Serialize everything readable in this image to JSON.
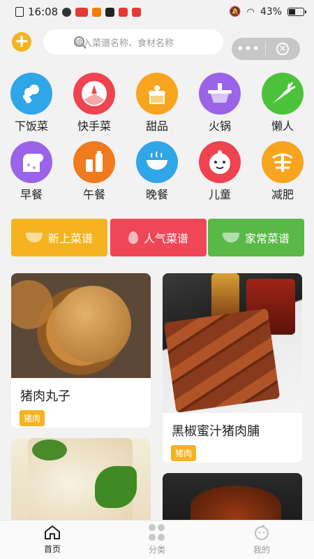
{
  "status_bar": {
    "time": "16:08",
    "battery": "43%"
  },
  "header": {
    "add_icon": "plus-icon",
    "search_placeholder": "输入菜谱名称、食材名称",
    "more_label": "•••",
    "close_label": "×"
  },
  "categories": [
    {
      "label": "下饭菜",
      "icon": "broccoli-icon",
      "color": "#2fa6e8"
    },
    {
      "label": "快手菜",
      "icon": "fan-icon",
      "color": "#ef4350"
    },
    {
      "label": "甜品",
      "icon": "cake-icon",
      "color": "#f7a51e"
    },
    {
      "label": "火锅",
      "icon": "hotpot-icon",
      "color": "#9a63e8"
    },
    {
      "label": "懒人",
      "icon": "carrot-icon",
      "color": "#4cc23b"
    },
    {
      "label": "早餐",
      "icon": "toast-icon",
      "color": "#9a63e8"
    },
    {
      "label": "午餐",
      "icon": "bottles-icon",
      "color": "#f07a1e"
    },
    {
      "label": "晚餐",
      "icon": "bowl-icon",
      "color": "#2fa6e8"
    },
    {
      "label": "儿童",
      "icon": "baby-icon",
      "color": "#ef4350"
    },
    {
      "label": "减肥",
      "icon": "scale-icon",
      "color": "#f7a51e"
    }
  ],
  "tabs": [
    {
      "label": "新上菜谱",
      "color": "#f6b321"
    },
    {
      "label": "人气菜谱",
      "color": "#ef4757"
    },
    {
      "label": "家常菜谱",
      "color": "#58b947"
    }
  ],
  "recipes": [
    {
      "title": "猪肉丸子",
      "tag": "猪肉"
    },
    {
      "title": "黑椒蜜汁猪肉脯",
      "tag": "猪肉"
    },
    {
      "title": "",
      "tag": ""
    },
    {
      "title": "",
      "tag": ""
    }
  ],
  "bottom_nav": [
    {
      "label": "首页",
      "icon": "home-icon",
      "active": true
    },
    {
      "label": "分类",
      "icon": "grid-icon",
      "active": false
    },
    {
      "label": "我的",
      "icon": "face-icon",
      "active": false
    }
  ]
}
